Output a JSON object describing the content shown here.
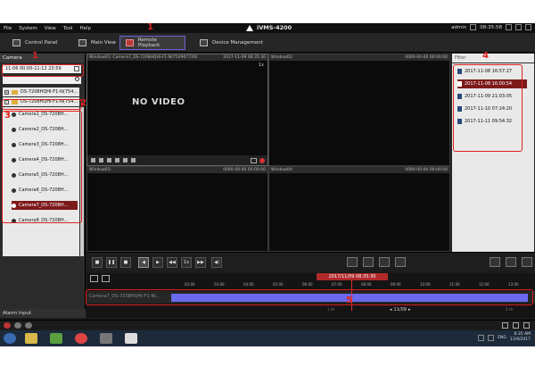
{
  "menu": [
    "File",
    "System",
    "View",
    "Tool",
    "Help"
  ],
  "app_title": "iVMS-4200",
  "user": "admin",
  "clock": "08:35:58",
  "toolbar": {
    "control_panel": "Control Panel",
    "main_view": "Main View",
    "remote_playback": "Remote Playback",
    "device_management": "Device Management"
  },
  "left_panel": {
    "header": "Camera",
    "date_range": "11:06 00:00-11:12 23:59",
    "devices": [
      "DS-7208HQHI-F1-N(754...",
      "DS-7208HQHI-F1-N(754..."
    ],
    "cameras": [
      "Camera1_DS-7208H...",
      "Camera2_DS-7208H...",
      "Camera3_DS-7208H...",
      "Camera4_DS-7208H...",
      "Camera5_DS-7208H...",
      "Camera6_DS-7208H...",
      "Camera7_DS-7208H...",
      "Camera8_DS-7208H..."
    ],
    "selected_camera_index": 6,
    "alarm_input": "Alarm Input"
  },
  "windows": [
    {
      "label": "Window01: Camera7_DS-7208HQHI-F1-N(754907726)",
      "time": "2017-11-09 08:35:30"
    },
    {
      "label": "Window02:",
      "time": "0000-00-00 00:00:00"
    },
    {
      "label": "Window03:",
      "time": "0000-00-00 00:00:00"
    },
    {
      "label": "Window04:",
      "time": "0000-00-00 00:00:00"
    }
  ],
  "no_video": "NO VIDEO",
  "speed_label": "1x",
  "right_panel": {
    "filter_placeholder": "Filter",
    "files": [
      "2017-11-08 16:57:27",
      "2017-11-08 16:00:54",
      "2017-11-09 21:03:05",
      "2017-11-10 07:24:20",
      "2017-11-11 09:54:32"
    ],
    "selected_file_index": 1
  },
  "playback_speed": "1x",
  "timeline": {
    "current": "2017/11/09 08:35:30",
    "camera": "Camera7_DS-7208HQHI-F1-N(...",
    "ticks": [
      "02:00",
      "03:00",
      "04:00",
      "05:00",
      "06:00",
      "07:00",
      "08:00",
      "09:00",
      "10:00",
      "11:00",
      "12:00",
      "13:00",
      "14:00"
    ],
    "zoom_date": "11/09",
    "scale_left": "1 Hr",
    "scale_right": "2 Hr"
  },
  "taskbar": {
    "lang": "ENG",
    "time": "8:35 AM",
    "date": "11/9/2017"
  },
  "annotations": [
    "1",
    "1",
    "2",
    "3",
    "4",
    "5"
  ],
  "colors": {
    "annotation": "#e02020",
    "selection": "#7d1a1a",
    "recording": "#6a6aee",
    "accent": "#6c63d9"
  }
}
